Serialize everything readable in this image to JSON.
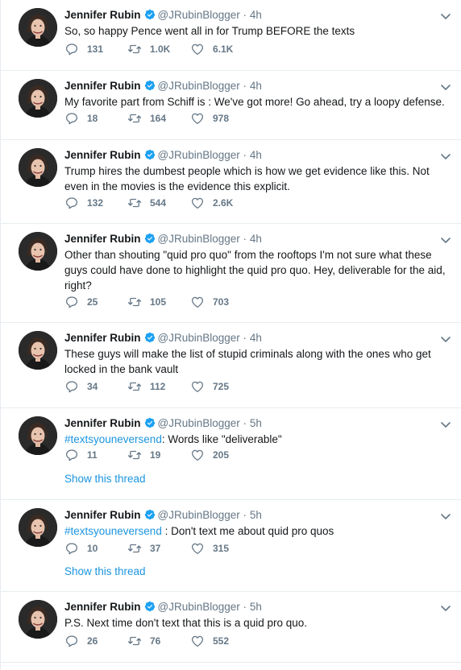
{
  "author": {
    "name": "Jennifer Rubin",
    "handle": "@JRubinBlogger",
    "dot": "·"
  },
  "tweets": [
    {
      "time": "4h",
      "text": "So, so happy Pence went all in for Trump BEFORE the texts",
      "hashtag": "",
      "replies": "131",
      "retweets": "1.0K",
      "likes": "6.1K",
      "show_thread": ""
    },
    {
      "time": "4h",
      "text": "My favorite part from Schiff is : We've got more! Go ahead, try a loopy defense.",
      "hashtag": "",
      "replies": "18",
      "retweets": "164",
      "likes": "978",
      "show_thread": ""
    },
    {
      "time": "4h",
      "text": "Trump hires the dumbest people which is how we get evidence like this. Not even in the movies is the evidence this explicit.",
      "hashtag": "",
      "replies": "132",
      "retweets": "544",
      "likes": "2.6K",
      "show_thread": ""
    },
    {
      "time": "4h",
      "text": "Other than shouting \"quid pro quo\" from the rooftops I'm not sure what these guys could have done to highlight the quid pro quo. Hey, deliverable for the aid, right?",
      "hashtag": "",
      "replies": "25",
      "retweets": "105",
      "likes": "703",
      "show_thread": ""
    },
    {
      "time": "4h",
      "text": "These guys will make the list of stupid criminals along with the ones who get locked in the bank vault",
      "hashtag": "",
      "replies": "34",
      "retweets": "112",
      "likes": "725",
      "show_thread": ""
    },
    {
      "time": "5h",
      "text": ": Words like \"deliverable\"",
      "hashtag": "#textsyouneversend",
      "replies": "11",
      "retweets": "19",
      "likes": "205",
      "show_thread": "Show this thread"
    },
    {
      "time": "5h",
      "text": " : Don't text me about quid pro quos",
      "hashtag": "#textsyouneversend",
      "replies": "10",
      "retweets": "37",
      "likes": "315",
      "show_thread": "Show this thread"
    },
    {
      "time": "5h",
      "text": "P.S. Next time don't text that this is a quid pro quo.",
      "hashtag": "",
      "replies": "26",
      "retweets": "76",
      "likes": "552",
      "show_thread": ""
    }
  ],
  "colors": {
    "accent": "#1b95e0",
    "verified": "#1da1f2",
    "muted": "#657786",
    "text": "#14171a",
    "border": "#e6ecf0"
  },
  "icons": {
    "verified": "verified-badge-icon",
    "caret": "chevron-down-icon",
    "reply": "reply-icon",
    "retweet": "retweet-icon",
    "like": "heart-icon"
  }
}
